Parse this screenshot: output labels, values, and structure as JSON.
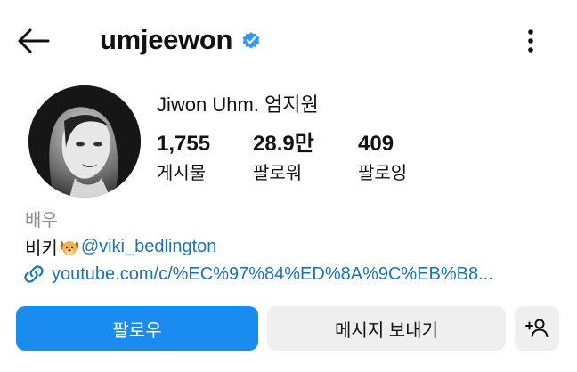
{
  "header": {
    "username": "umjeewon",
    "verified_color": "#3897f0"
  },
  "profile": {
    "display_name": "Jiwon Uhm. 엄지원",
    "stats": [
      {
        "value": "1,755",
        "label": "게시물"
      },
      {
        "value": "28.9만",
        "label": "팔로워"
      },
      {
        "value": "409",
        "label": "팔로잉"
      }
    ]
  },
  "bio": {
    "category": "배우",
    "line_prefix": "비키",
    "line_emoji": "dog-face-emoji",
    "handle": "@viki_bedlington",
    "link": "youtube.com/c/%EC%97%84%ED%8A%9C%EB%B8..."
  },
  "actions": {
    "follow_label": "팔로우",
    "message_label": "메시지 보내기",
    "add_user_icon": "add-person-icon",
    "follow_color": "#1a8cf0"
  },
  "icons": {
    "back": "back-arrow-icon",
    "more": "more-vertical-icon",
    "link": "link-icon"
  }
}
